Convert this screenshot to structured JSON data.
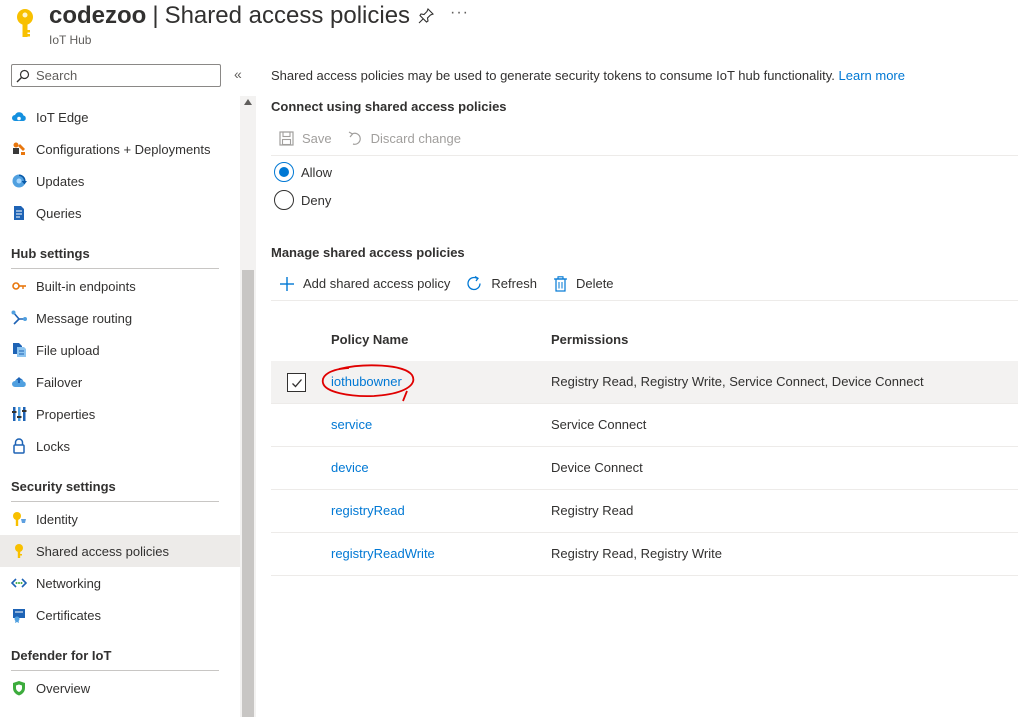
{
  "header": {
    "resource_name": "codezoo",
    "separator": "|",
    "page_title": "Shared access policies",
    "subtitle": "IoT Hub",
    "more_label": "···"
  },
  "sidebar": {
    "search_placeholder": "Search",
    "collapse_label": "«",
    "items_top": [
      {
        "label": "IoT Edge",
        "icon": "cloud-icon"
      },
      {
        "label": "Configurations + Deployments",
        "icon": "configuration-icon"
      },
      {
        "label": "Updates",
        "icon": "updates-icon"
      },
      {
        "label": "Queries",
        "icon": "queries-icon"
      }
    ],
    "sections": [
      {
        "title": "Hub settings",
        "items": [
          {
            "label": "Built-in endpoints",
            "icon": "endpoint-icon"
          },
          {
            "label": "Message routing",
            "icon": "routing-icon"
          },
          {
            "label": "File upload",
            "icon": "file-upload-icon"
          },
          {
            "label": "Failover",
            "icon": "failover-icon"
          },
          {
            "label": "Properties",
            "icon": "properties-icon"
          },
          {
            "label": "Locks",
            "icon": "lock-icon"
          }
        ]
      },
      {
        "title": "Security settings",
        "items": [
          {
            "label": "Identity",
            "icon": "identity-icon"
          },
          {
            "label": "Shared access policies",
            "icon": "key-icon",
            "selected": true
          },
          {
            "label": "Networking",
            "icon": "networking-icon"
          },
          {
            "label": "Certificates",
            "icon": "certificate-icon"
          }
        ]
      },
      {
        "title": "Defender for IoT",
        "items": [
          {
            "label": "Overview",
            "icon": "shield-icon"
          }
        ]
      }
    ]
  },
  "main": {
    "intro_text": "Shared access policies may be used to generate security tokens to consume IoT hub functionality.",
    "learn_more": "Learn more",
    "connect_title": "Connect using shared access policies",
    "save_label": "Save",
    "discard_label": "Discard change",
    "radio_options": [
      {
        "label": "Allow",
        "checked": true
      },
      {
        "label": "Deny",
        "checked": false
      }
    ],
    "manage_title": "Manage shared access policies",
    "add_label": "Add shared access policy",
    "refresh_label": "Refresh",
    "delete_label": "Delete",
    "table": {
      "columns": [
        "Policy Name",
        "Permissions"
      ],
      "rows": [
        {
          "name": "iothubowner",
          "permissions": "Registry Read, Registry Write, Service Connect, Device Connect",
          "selected": true
        },
        {
          "name": "service",
          "permissions": "Service Connect",
          "selected": false
        },
        {
          "name": "device",
          "permissions": "Device Connect",
          "selected": false
        },
        {
          "name": "registryRead",
          "permissions": "Registry Read",
          "selected": false
        },
        {
          "name": "registryReadWrite",
          "permissions": "Registry Read, Registry Write",
          "selected": false
        }
      ]
    }
  },
  "colors": {
    "accent": "#0078d4",
    "key_icon": "#f8c000",
    "annotation": "#e00000"
  }
}
